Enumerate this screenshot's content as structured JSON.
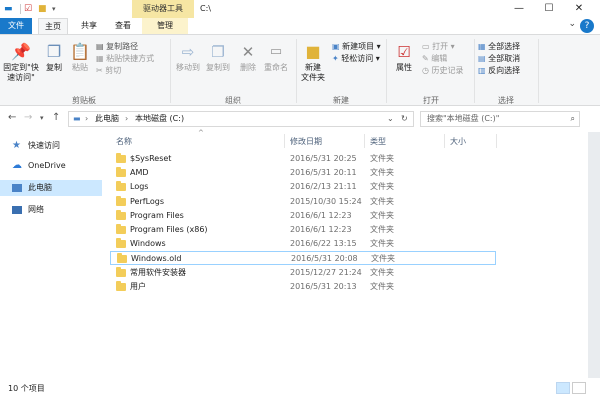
{
  "titlebar": {
    "drive_tools": "驱动器工具",
    "path": "C:\\",
    "minimize": "—",
    "maximize": "☐",
    "close": "✕"
  },
  "tabs": {
    "file": "文件",
    "home": "主页",
    "share": "共享",
    "view": "查看",
    "manage": "管理"
  },
  "ribbon": {
    "pin": "固定到\"快\n速访问\"",
    "copy": "复制",
    "paste": "粘贴",
    "copy_path": "复制路径",
    "paste_shortcut": "粘贴快捷方式",
    "cut": "剪切",
    "clipboard": "剪贴板",
    "move_to": "移动到",
    "copy_to": "复制到",
    "delete": "删除",
    "rename": "重命名",
    "organize": "组织",
    "new_item": "新建项目",
    "easy_access": "轻松访问",
    "new_folder": "新建\n文件夹",
    "new": "新建",
    "properties": "属性",
    "open": "打开",
    "edit": "编辑",
    "history": "历史记录",
    "open_group": "打开",
    "select_all": "全部选择",
    "select_none": "全部取消",
    "invert": "反向选择",
    "select_group": "选择"
  },
  "address": {
    "this_pc": "此电脑",
    "drive": "本地磁盘 (C:)",
    "search_placeholder": "搜索\"本地磁盘 (C:)\""
  },
  "sidebar": {
    "items": [
      {
        "label": "快速访问"
      },
      {
        "label": "OneDrive"
      },
      {
        "label": "此电脑"
      },
      {
        "label": "网络"
      }
    ]
  },
  "columns": {
    "name": "名称",
    "date": "修改日期",
    "type": "类型",
    "size": "大小"
  },
  "files": [
    {
      "name": "$SysReset",
      "date": "2016/5/31 20:25",
      "type": "文件夹"
    },
    {
      "name": "AMD",
      "date": "2016/5/31 20:11",
      "type": "文件夹"
    },
    {
      "name": "Logs",
      "date": "2016/2/13 21:11",
      "type": "文件夹"
    },
    {
      "name": "PerfLogs",
      "date": "2015/10/30 15:24",
      "type": "文件夹"
    },
    {
      "name": "Program Files",
      "date": "2016/6/1 12:23",
      "type": "文件夹"
    },
    {
      "name": "Program Files (x86)",
      "date": "2016/6/1 12:23",
      "type": "文件夹"
    },
    {
      "name": "Windows",
      "date": "2016/6/22 13:15",
      "type": "文件夹"
    },
    {
      "name": "Windows.old",
      "date": "2016/5/31 20:08",
      "type": "文件夹"
    },
    {
      "name": "常用软件安装器",
      "date": "2015/12/27 21:24",
      "type": "文件夹"
    },
    {
      "name": "用户",
      "date": "2016/5/31 20:13",
      "type": "文件夹"
    }
  ],
  "status": {
    "count": "10 个项目"
  }
}
